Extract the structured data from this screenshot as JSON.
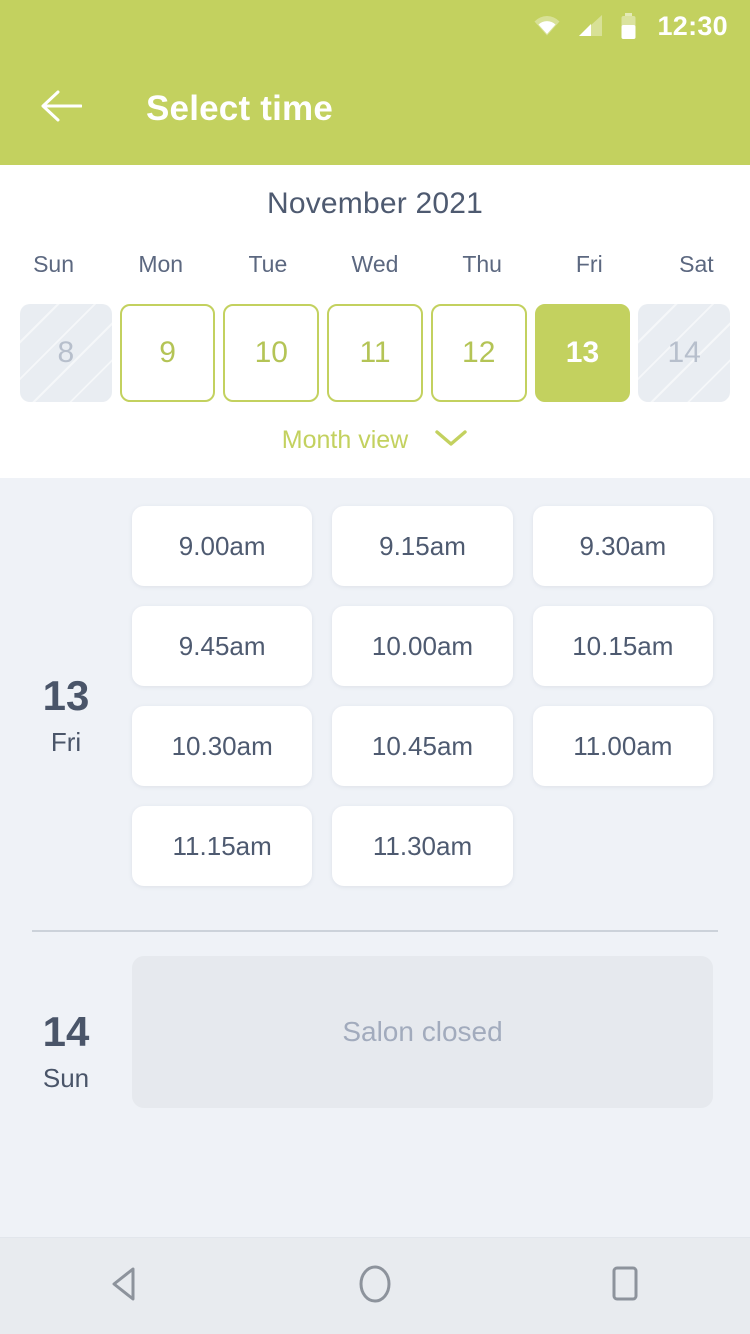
{
  "status_bar": {
    "time": "12:30",
    "icons": [
      "wifi-icon",
      "cellular-signal-icon",
      "battery-icon"
    ]
  },
  "app_bar": {
    "back_icon": "back-arrow-icon",
    "title": "Select time"
  },
  "calendar": {
    "month_title": "November 2021",
    "weekday_headers": [
      "Sun",
      "Mon",
      "Tue",
      "Wed",
      "Thu",
      "Fri",
      "Sat"
    ],
    "days": [
      {
        "number": "8",
        "state": "disabled"
      },
      {
        "number": "9",
        "state": "available"
      },
      {
        "number": "10",
        "state": "available"
      },
      {
        "number": "11",
        "state": "available"
      },
      {
        "number": "12",
        "state": "available"
      },
      {
        "number": "13",
        "state": "selected"
      },
      {
        "number": "14",
        "state": "disabled"
      }
    ],
    "month_view_label": "Month view",
    "month_view_chevron": "chevron-down-icon"
  },
  "schedule": [
    {
      "day_number": "13",
      "day_name": "Fri",
      "slots": [
        "9.00am",
        "9.15am",
        "9.30am",
        "9.45am",
        "10.00am",
        "10.15am",
        "10.30am",
        "10.45am",
        "11.00am",
        "11.15am",
        "11.30am"
      ]
    },
    {
      "day_number": "14",
      "day_name": "Sun",
      "closed_message": "Salon closed"
    }
  ],
  "nav_bar": {
    "back": "android-back-icon",
    "home": "android-home-icon",
    "recents": "android-recents-icon"
  },
  "colors": {
    "accent_green": "#c3d15f",
    "page_background": "#eff2f7",
    "card_white": "#ffffff",
    "text_dark": "#4e5a70",
    "text_muted": "#a2abbd",
    "disabled_cell": "#e9edf2"
  }
}
